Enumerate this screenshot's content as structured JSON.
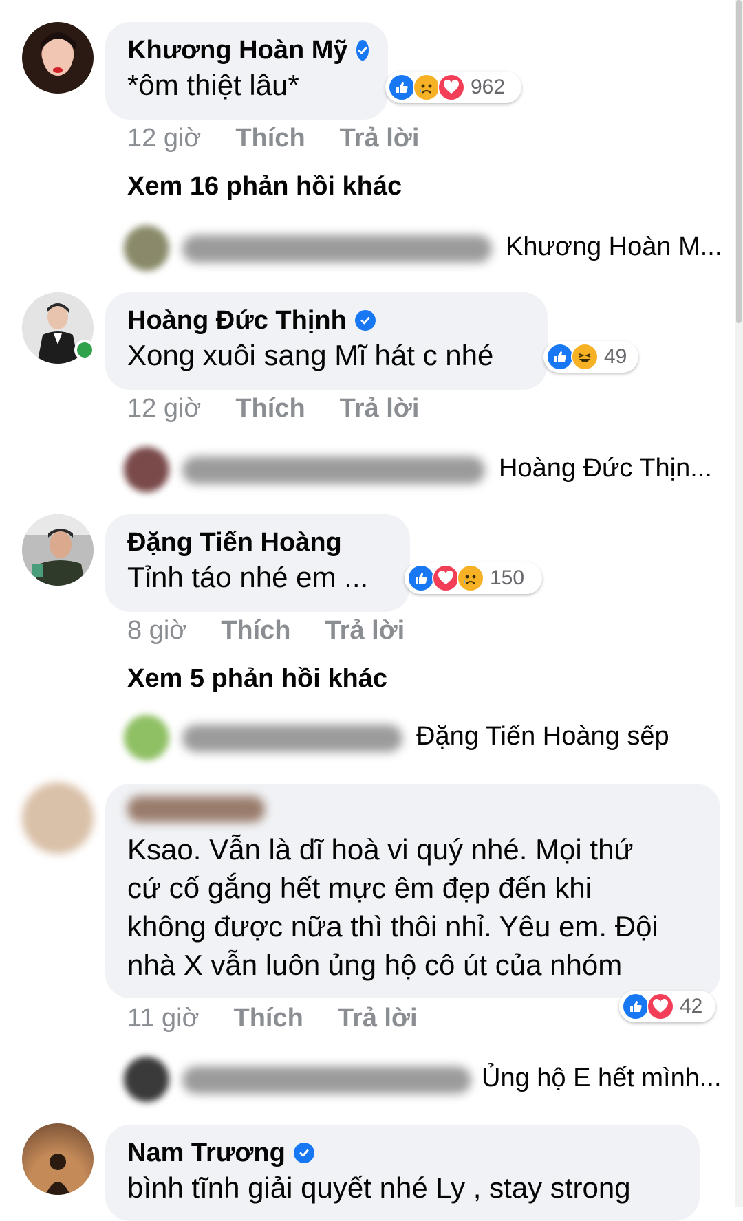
{
  "comments": [
    {
      "name": "Khương Hoàn Mỹ",
      "verified": true,
      "text": "*ôm thiệt lâu*",
      "reactions": [
        "like",
        "sad",
        "love"
      ],
      "reaction_count": "962",
      "time": "12 giờ",
      "like_label": "Thích",
      "reply_label": "Trả lời",
      "more_replies": "Xem 16 phản hồi khác",
      "reply_preview": "Khương Hoàn M..."
    },
    {
      "name": "Hoàng Đức Thịnh",
      "verified": true,
      "online": true,
      "text": "Xong xuôi sang Mĩ hát c nhé",
      "reactions": [
        "like",
        "haha"
      ],
      "reaction_count": "49",
      "time": "12 giờ",
      "like_label": "Thích",
      "reply_label": "Trả lời",
      "reply_preview": "Hoàng Đức Thịn..."
    },
    {
      "name": "Đặng Tiến Hoàng",
      "verified": false,
      "text": "Tỉnh táo nhé em ...",
      "reactions": [
        "like",
        "love",
        "sad"
      ],
      "reaction_count": "150",
      "time": "8 giờ",
      "like_label": "Thích",
      "reply_label": "Trả lời",
      "more_replies": "Xem 5 phản hồi khác",
      "reply_preview": "Đặng Tiến Hoàng sếp"
    },
    {
      "verified": false,
      "text_lines": [
        "Ksao. Vẫn là dĩ hoà vi quý nhé. Mọi thứ",
        "cứ cố gắng hết mực êm đẹp đến khi",
        "không được nữa thì thôi nhỉ. Yêu em. Đội",
        "nhà X vẫn luôn ủng hộ cô út của nhóm"
      ],
      "reactions": [
        "like",
        "love"
      ],
      "reaction_count": "42",
      "time": "11 giờ",
      "like_label": "Thích",
      "reply_label": "Trả lời",
      "reply_preview": "Ủng hộ E hết mình..."
    },
    {
      "name": "Nam Trương",
      "verified": true,
      "text": "bình tĩnh giải quyết nhé Ly , stay strong"
    }
  ],
  "colors": {
    "bubble": "#f0f2f5",
    "secondary_text": "#8a8d91",
    "verified": "#1877f2",
    "like": "#1877f2",
    "love": "#f33e58",
    "sad": "#f7b125",
    "online": "#31a24c"
  },
  "icons": {
    "verified": "verified-badge-icon",
    "like": "like-reaction-icon",
    "love": "love-reaction-icon",
    "sad": "sad-reaction-icon",
    "haha": "haha-reaction-icon"
  }
}
